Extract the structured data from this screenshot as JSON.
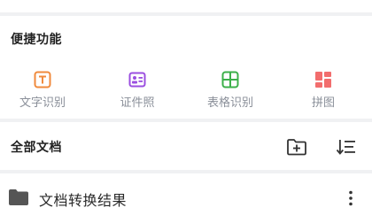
{
  "quick_actions": {
    "title": "便捷功能",
    "items": [
      {
        "label": "文字识别",
        "icon": "text-recognition-icon",
        "color": "#f08a3c"
      },
      {
        "label": "证件照",
        "icon": "id-photo-icon",
        "color": "#9b4fe0"
      },
      {
        "label": "表格识别",
        "icon": "table-recognition-icon",
        "color": "#3cb04a"
      },
      {
        "label": "拼图",
        "icon": "collage-icon",
        "color": "#f26d6d"
      }
    ]
  },
  "documents": {
    "title": "全部文档",
    "new_folder_icon": "add-folder-icon",
    "sort_icon": "sort-icon",
    "items": [
      {
        "name": "文档转换结果",
        "icon": "folder-icon",
        "menu_icon": "more-vertical-icon"
      }
    ]
  }
}
